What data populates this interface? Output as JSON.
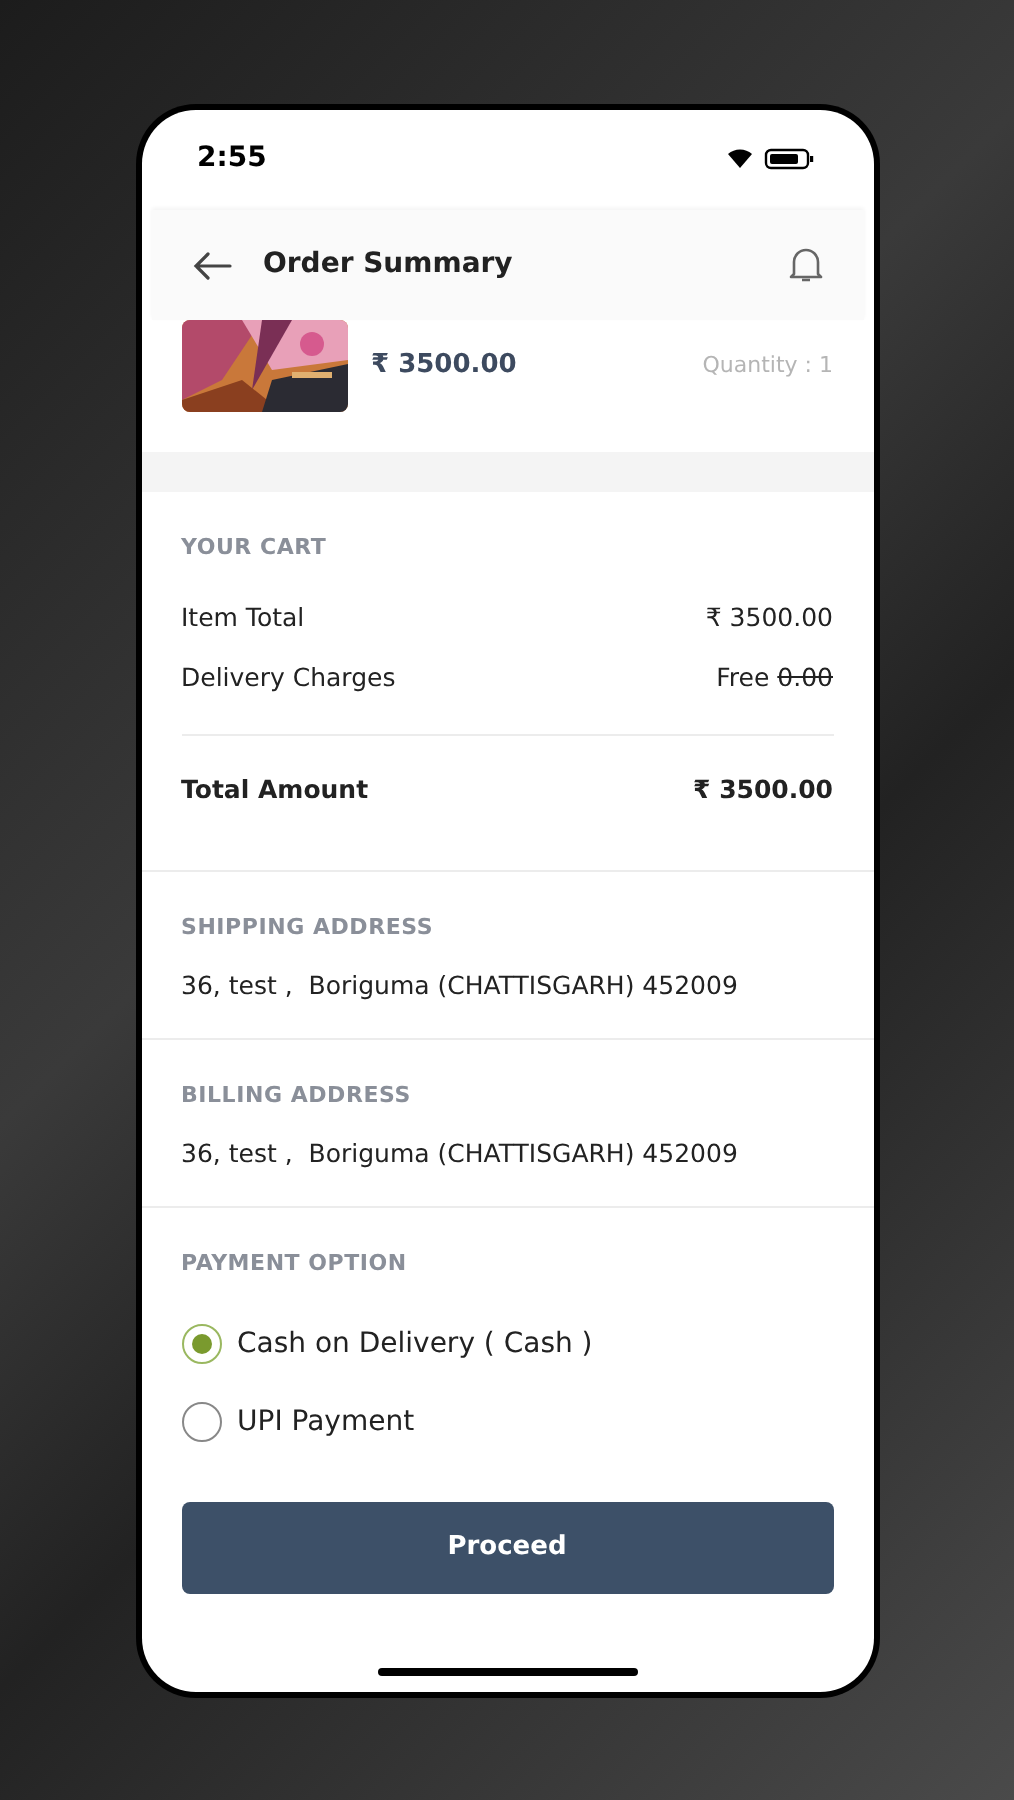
{
  "status_bar": {
    "time": "2:55"
  },
  "header": {
    "title": "Order Summary"
  },
  "product": {
    "kind": "picture",
    "price": "₹ 3500.00",
    "quantity": "Quantity : 1"
  },
  "cart": {
    "heading": "YOUR CART",
    "rows": [
      {
        "label": "Item Total",
        "value": "₹ 3500.00"
      },
      {
        "label": "Delivery Charges",
        "value": "Free",
        "struck_value": "0.00"
      }
    ],
    "total": {
      "label": "Total Amount",
      "value": "₹ 3500.00"
    }
  },
  "shipping_address": {
    "heading": "SHIPPING ADDRESS",
    "text": "36, test ,  Boriguma (CHATTISGARH) 452009"
  },
  "billing_address": {
    "heading": "BILLING ADDRESS",
    "text": "36, test ,  Boriguma (CHATTISGARH) 452009"
  },
  "payment": {
    "heading": "PAYMENT OPTION",
    "options": [
      {
        "label": "Cash on Delivery ( Cash )",
        "selected": true
      },
      {
        "label": "UPI Payment",
        "selected": false
      }
    ]
  },
  "proceed_button": {
    "label": "Proceed"
  }
}
